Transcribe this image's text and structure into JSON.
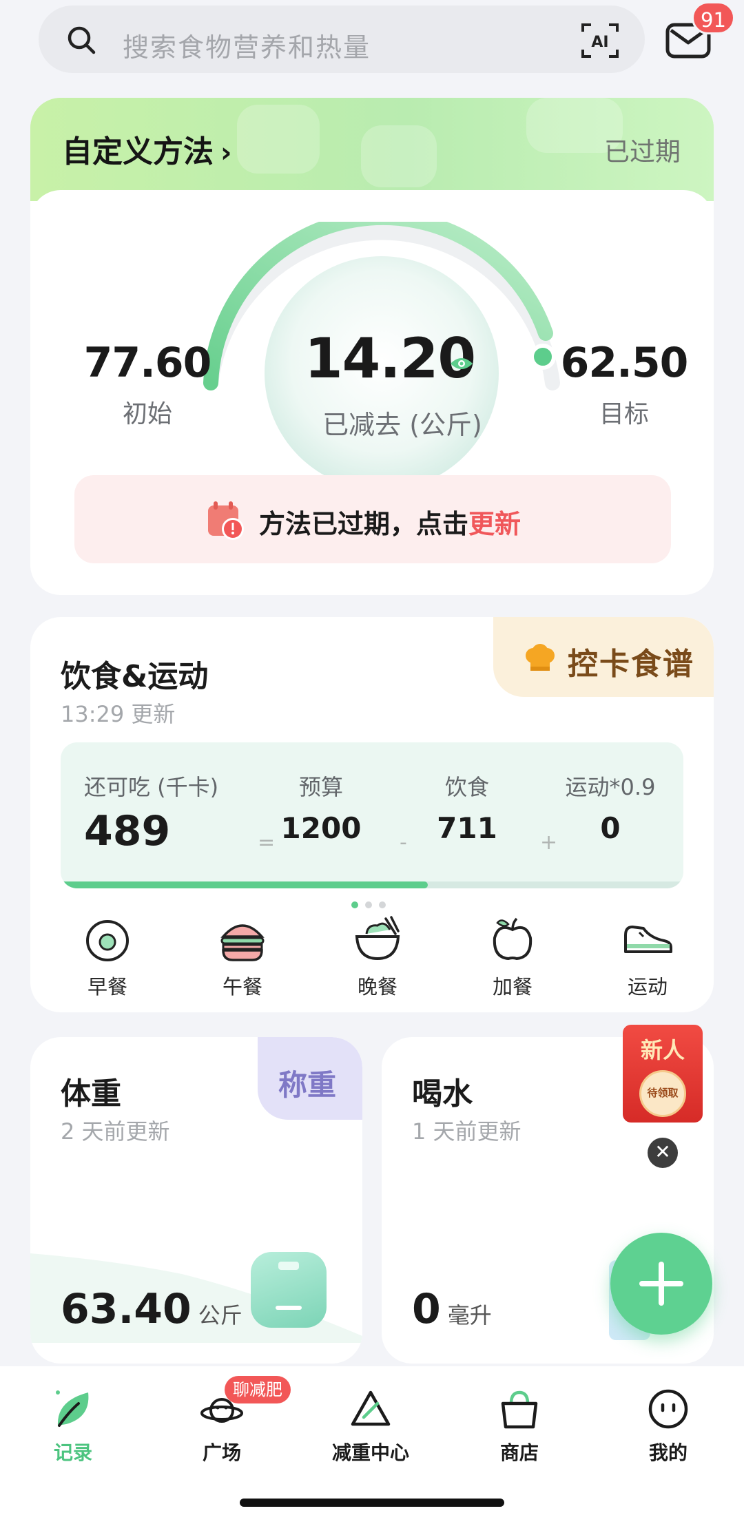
{
  "search": {
    "placeholder": "搜索食物营养和热量"
  },
  "mail": {
    "badge": "91"
  },
  "method": {
    "title": "自定义方法",
    "status": "已过期",
    "start_weight": "77.60",
    "start_label": "初始",
    "lost_weight": "14.20",
    "lost_label": "已减去 (公斤)",
    "goal_weight": "62.50",
    "goal_label": "目标",
    "expire_text": "方法已过期，点击",
    "expire_link": "更新"
  },
  "diet": {
    "title": "饮食&运动",
    "updated": "13:29 更新",
    "recipe_tab": "控卡食谱",
    "remain_label": "还可吃 (千卡)",
    "remain_value": "489",
    "budget_label": "预算",
    "budget_value": "1200",
    "food_label": "饮食",
    "food_value": "711",
    "exercise_label": "运动*0.9",
    "exercise_value": "0",
    "op_eq": "=",
    "op_minus": "-",
    "op_plus": "+",
    "progress": 0.59,
    "meals": [
      {
        "label": "早餐",
        "icon": "egg-icon"
      },
      {
        "label": "午餐",
        "icon": "burger-icon"
      },
      {
        "label": "晚餐",
        "icon": "bowl-icon"
      },
      {
        "label": "加餐",
        "icon": "apple-icon"
      },
      {
        "label": "运动",
        "icon": "shoe-icon"
      }
    ]
  },
  "weight": {
    "title": "体重",
    "updated": "2 天前更新",
    "tab": "称重",
    "value": "63.40",
    "unit": "公斤"
  },
  "water": {
    "title": "喝水",
    "updated": "1 天前更新",
    "value": "0",
    "unit": "毫升"
  },
  "newbie": {
    "title": "新人",
    "coin": "待领取"
  },
  "nav": {
    "items": [
      {
        "label": "记录",
        "icon": "leaf-icon"
      },
      {
        "label": "广场",
        "icon": "planet-icon"
      },
      {
        "label": "减重中心",
        "icon": "triangle-icon"
      },
      {
        "label": "商店",
        "icon": "bag-icon"
      },
      {
        "label": "我的",
        "icon": "face-icon"
      }
    ],
    "chat_badge": "聊减肥"
  },
  "colors": {
    "accent": "#5dcd8c",
    "danger": "#f0575a"
  }
}
